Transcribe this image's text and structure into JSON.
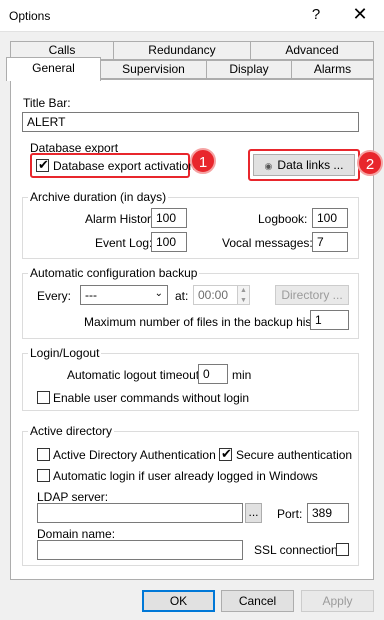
{
  "window": {
    "title": "Options",
    "help_label": "?",
    "close_label": "✕"
  },
  "tabs": {
    "row1": [
      "Calls",
      "Redundancy",
      "Advanced"
    ],
    "row2": [
      "General",
      "Supervision",
      "Display",
      "Alarms"
    ],
    "active": "General"
  },
  "title_bar": {
    "label": "Title Bar:",
    "value": "ALERT"
  },
  "database_export": {
    "title": "Database export",
    "activation_label": "Database export activation",
    "activation_checked": true,
    "data_links_label": "Data links ...",
    "badge1": "1",
    "badge2": "2"
  },
  "archive": {
    "title": "Archive duration (in days)",
    "alarm_history_label": "Alarm History:",
    "alarm_history_value": "100",
    "logbook_label": "Logbook:",
    "logbook_value": "100",
    "event_log_label": "Event Log:",
    "event_log_value": "100",
    "vocal_label": "Vocal messages:",
    "vocal_value": "7"
  },
  "backup": {
    "title": "Automatic configuration backup",
    "every_label": "Every:",
    "every_value": "---",
    "at_label": "at:",
    "at_value": "00:00",
    "directory_label": "Directory ...",
    "max_files_label": "Maximum number of files in the backup history:",
    "max_files_value": "1"
  },
  "login": {
    "title": "Login/Logout",
    "timeout_label": "Automatic logout timeout:",
    "timeout_value": "0",
    "timeout_unit": "min",
    "no_login_label": "Enable user commands without login",
    "no_login_checked": false
  },
  "active_directory": {
    "title": "Active directory",
    "ad_auth_label": "Active Directory Authentication",
    "ad_auth_checked": false,
    "secure_label": "Secure authentication",
    "secure_checked": true,
    "auto_login_label": "Automatic login if user already logged in Windows",
    "auto_login_checked": false,
    "ldap_label": "LDAP server:",
    "ldap_value": "",
    "browse_label": "...",
    "port_label": "Port:",
    "port_value": "389",
    "domain_label": "Domain name:",
    "domain_value": "",
    "ssl_label": "SSL connection",
    "ssl_checked": false
  },
  "footer": {
    "ok_label": "OK",
    "cancel_label": "Cancel",
    "apply_label": "Apply"
  },
  "colors": {
    "highlight": "#e8262c",
    "accent": "#0078d7"
  }
}
